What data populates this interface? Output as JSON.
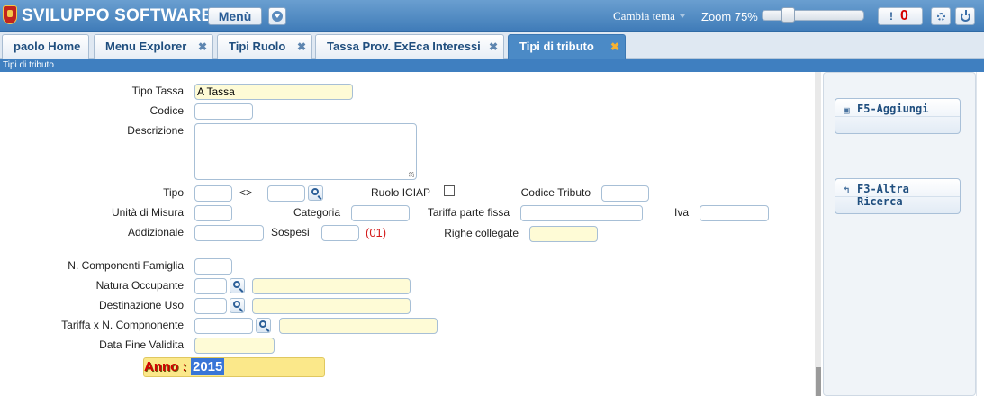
{
  "header": {
    "app_title": "SVILUPPO SOFTWARE",
    "menu_label": "Menù",
    "theme_label": "Cambia tema",
    "zoom_label": "Zoom 75%",
    "zoom_value_percent": 75,
    "alert_count": "0"
  },
  "tabs": [
    {
      "label": "paolo Home",
      "closable": false,
      "active": false
    },
    {
      "label": "Menu Explorer",
      "closable": true,
      "active": false
    },
    {
      "label": "Tipi Ruolo",
      "closable": true,
      "active": false
    },
    {
      "label": "Tassa Prov. ExEca Interessi",
      "closable": true,
      "active": false
    },
    {
      "label": "Tipi di tributo",
      "closable": true,
      "active": true
    }
  ],
  "breadcrumb": "Tipi di tributo",
  "form": {
    "tipo_tassa": {
      "label": "Tipo Tassa",
      "value": "A Tassa"
    },
    "codice": {
      "label": "Codice",
      "value": ""
    },
    "descrizione": {
      "label": "Descrizione",
      "value": ""
    },
    "tipo": {
      "label": "Tipo",
      "separator": "<>",
      "value_from": "",
      "value_to": ""
    },
    "ruolo_iciap": {
      "label": "Ruolo ICIAP",
      "checked": false
    },
    "codice_tributo": {
      "label": "Codice Tributo",
      "value": ""
    },
    "unita_misura": {
      "label": "Unità di Misura",
      "value": ""
    },
    "categoria": {
      "label": "Categoria",
      "value": ""
    },
    "tariffa_parte_fissa": {
      "label": "Tariffa parte fissa",
      "value": ""
    },
    "iva": {
      "label": "Iva",
      "value": ""
    },
    "addizionale": {
      "label": "Addizionale",
      "value": ""
    },
    "sospesi": {
      "label": "Sospesi",
      "value": "",
      "count": "(01)"
    },
    "righe_collegate": {
      "label": "Righe collegate",
      "value": ""
    },
    "n_componenti": {
      "label": "N. Componenti Famiglia",
      "value": ""
    },
    "natura_occupante": {
      "label": "Natura Occupante",
      "code": "",
      "description": ""
    },
    "destinazione_uso": {
      "label": "Destinazione Uso",
      "code": "",
      "description": ""
    },
    "tariffa_n_componente": {
      "label": "Tariffa x N. Compnonente",
      "code": "",
      "description": ""
    },
    "data_fine_validita": {
      "label": "Data Fine Validita",
      "value": ""
    },
    "anno": {
      "label": "Anno :",
      "value": "2015"
    }
  },
  "actions": {
    "add_label": "F5-Aggiungi",
    "search_label": "F3-Altra Ricerca"
  },
  "colors": {
    "header_blue": "#4f8cc9",
    "active_tab": "#4b8ac6",
    "readonly_yellow": "#fefbd6",
    "alert_red": "#d40000"
  }
}
